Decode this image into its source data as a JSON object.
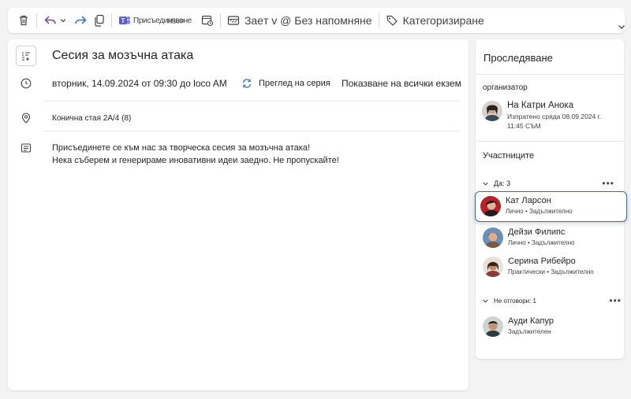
{
  "toolbar": {
    "join_label": "Присъедин",
    "join_overlay": "яване",
    "rsvp_label": "RSVP",
    "status_label": "Заeт v @ Без напомняне",
    "categorize_label": "Категоризиране"
  },
  "event": {
    "title": "Сесия за мозъчна атака",
    "datetime": "вторник, 14.09.2024 от 09:30 до loco AM",
    "series_label": "Преглед на серия",
    "all_instances_label": "Показване на всички екземпляри",
    "location": "Конична стая 2A/4 (8)",
    "description_line1": "Присъединете се към нас за творческа сесия за мозъчна атака!",
    "description_line2": "Нека съберем и генерираме иновативни идеи заедно. Не пропускайте!"
  },
  "tracking": {
    "title": "Проследяване",
    "organizer_label": "организатор",
    "organizer": {
      "name": "На Катри Анока",
      "sent_line1": "Изпратено сряда 08.09.2024 г.",
      "sent_line2": "11:45 СЪМ"
    },
    "attendees_label": "Участниците",
    "group_yes": "Да: 3",
    "group_no": "Не отговори: 1",
    "more": "•••",
    "attendees_yes": [
      {
        "name": "Кат Ларсон",
        "meta": "Лично • Задължително"
      },
      {
        "name": "Дейзи Филипс",
        "meta": "Лично • Задължително"
      },
      {
        "name": "Серина Рибейро",
        "meta": "Практически • Задължително"
      }
    ],
    "attendees_no": [
      {
        "name": "Ауди Капур",
        "meta": "Задължителен"
      }
    ]
  },
  "colors": {
    "accent": "#2f6fb4",
    "undo": "#7a3f9e",
    "redo": "#2f6fb4",
    "teams": "#5b5fc7"
  }
}
